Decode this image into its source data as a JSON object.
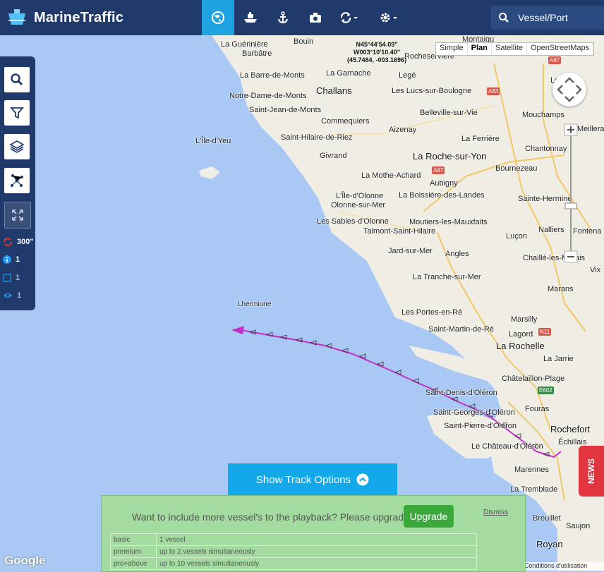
{
  "header": {
    "brand": "MarineTraffic",
    "search_label": "Vessel/Port",
    "nav": [
      {
        "name": "globe-icon",
        "active": true
      },
      {
        "name": "ship-icon",
        "active": false
      },
      {
        "name": "anchor-icon",
        "active": false
      },
      {
        "name": "camera-icon",
        "active": false
      },
      {
        "name": "refresh-icon",
        "active": false
      },
      {
        "name": "gear-icon",
        "active": false
      }
    ]
  },
  "toolbar": {
    "refresh": "300\"",
    "info_count": "1",
    "box_count": "1",
    "eye_count": "1"
  },
  "map": {
    "map_types": [
      "Simple",
      "Plan",
      "Satellite",
      "OpenStreetMaps"
    ],
    "selected_type": "Plan",
    "coords": {
      "lat": "N45°44'54.09\"",
      "lon": "W003°10'10.40\"",
      "dec": "(45.7484, -003.1696)"
    },
    "vessel_name": "Lhermione",
    "track_color": "#c030c8",
    "places": [
      "La Guérinière",
      "Barbâtre",
      "Bouin",
      "Montaigu",
      "Rocheservière",
      "La Barre-de-Monts",
      "La Garnache",
      "Legé",
      "Notre-Dame-de-Monts",
      "Challans",
      "Les Lucs-sur-Boulogne",
      "Saint-Jean-de-Monts",
      "Commequiers",
      "Belleville-sur-Vie",
      "L'Île-d'Yeu",
      "Saint-Hilaire-de-Riez",
      "Aizenay",
      "La Ferrière",
      "Givrand",
      "La Roche-sur-Yon",
      "La Mothe-Achard",
      "Aubigny",
      "L'Île-d'Olonne",
      "La Boissière-des-Landes",
      "Olonne-sur-Mer",
      "Les Sables-d'Olonne",
      "Moutiers-les-Mauxfaits",
      "Talmont-Saint-Hilaire",
      "Jard-sur-Mer",
      "Angles",
      "La Tranche-sur-Mer",
      "Les Portes-en-Ré",
      "Saint-Martin-de-Ré",
      "La Rochelle",
      "Châtelaillon-Plage",
      "Saint-Denis-d'Oléron",
      "Fouras",
      "Saint-Georges-d'Oléron",
      "Saint-Pierre-d'Oléron",
      "Rochefort",
      "Le Château-d'Oléron",
      "Marennes",
      "La Tremblade",
      "Les H",
      "Mouchamps",
      "Meillera",
      "Chantonnay",
      "Bournezeau",
      "Sainte-Hermine",
      "Luçon",
      "Nalliers",
      "Fontena",
      "Chaillé-les-Marais",
      "Vix",
      "Marans",
      "Marsilly",
      "Lagord",
      "La Jarrie",
      "Échillais",
      "Breuillet",
      "Saujon",
      "Royan"
    ],
    "roads": [
      "A87",
      "A83",
      "A87",
      "N11",
      "E602"
    ]
  },
  "track_button": "Show Track Options",
  "upgrade": {
    "message": "Want to include more vessel's to the playback? Please upgrade",
    "button": "Upgrade",
    "dismiss": "Dismiss",
    "plans": [
      {
        "plan": "basic",
        "desc": "1 vessel"
      },
      {
        "plan": "premium",
        "desc": "up to 2 vessels simultaneously"
      },
      {
        "plan": "pro+above",
        "desc": "up to 10 vessels simultaneously"
      }
    ]
  },
  "news_label": "NEWS",
  "google_label": "Google",
  "terms_label": "Conditions d'utilisation"
}
